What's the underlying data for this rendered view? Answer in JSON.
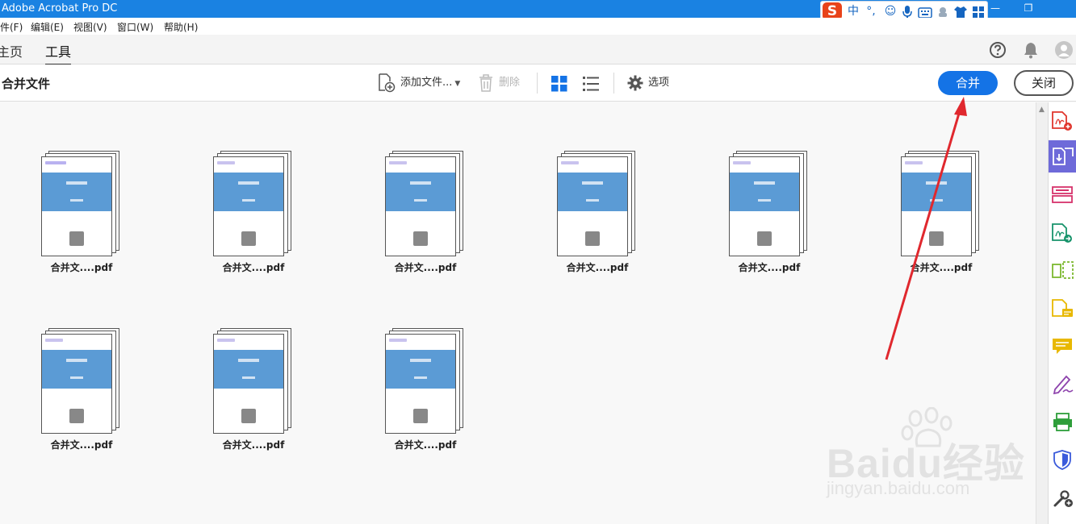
{
  "window": {
    "title": "Adobe Acrobat Pro DC"
  },
  "ime": {
    "items": [
      "中",
      "°,"
    ]
  },
  "menubar": {
    "items": [
      "件(F)",
      "编辑(E)",
      "视图(V)",
      "窗口(W)",
      "帮助(H)"
    ]
  },
  "tabs": [
    {
      "label": "主页"
    },
    {
      "label": "工具",
      "active": true
    }
  ],
  "toolbar": {
    "title": "合并文件",
    "add_files": "添加文件...",
    "delete": "删除",
    "options": "选项",
    "merge_button": "合并",
    "close_button": "关闭"
  },
  "files": [
    {
      "name": "合并文....pdf"
    },
    {
      "name": "合并文....pdf"
    },
    {
      "name": "合并文....pdf"
    },
    {
      "name": "合并文....pdf"
    },
    {
      "name": "合并文....pdf"
    },
    {
      "name": "合并文....pdf"
    },
    {
      "name": "合并文....pdf"
    },
    {
      "name": "合并文....pdf"
    },
    {
      "name": "合并文....pdf"
    }
  ],
  "watermark": {
    "brand": "Baidu经验",
    "url": "jingyan.baidu.com"
  },
  "colors": {
    "titlebar": "#1a82e2",
    "primary_button": "#1473e6",
    "annotation_arrow": "#e0282e",
    "rail_active": "#6e6ad9"
  },
  "right_rail_icons": [
    "create-pdf-icon",
    "combine-files-icon",
    "organize-pages-icon",
    "export-pdf-icon",
    "edit-pdf-icon",
    "fill-sign-icon",
    "comment-icon",
    "sign-icon",
    "print-production-icon",
    "protect-icon",
    "more-tools-icon"
  ]
}
